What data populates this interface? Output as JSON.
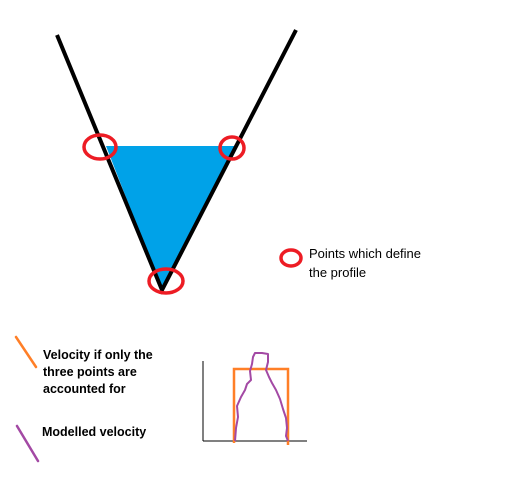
{
  "legend": {
    "points_line1": "Points which define",
    "points_line2": "the profile",
    "velocity_line1": "Velocity if only the",
    "velocity_line2": "three points are",
    "velocity_line3": "accounted for",
    "modelled": "Modelled velocity"
  },
  "colors": {
    "channel_outline": "#000000",
    "water_fill": "#00a2e8",
    "point_marker": "#ed1c24",
    "three_point_velocity": "#ff7f27",
    "modelled_velocity": "#a349a4",
    "axes": "#000000"
  }
}
